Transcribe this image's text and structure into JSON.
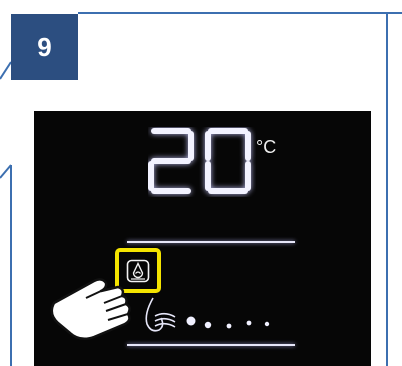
{
  "step": {
    "number": "9"
  },
  "display": {
    "temperature": "20",
    "unit": "°C"
  },
  "icons": {
    "button": "ventilation-icon",
    "fan_level": "fan-speed-icon",
    "pointer": "hand-pointer-icon"
  },
  "colors": {
    "badge": "#2c4e80",
    "frame_line": "#3c6fb0",
    "panel": "#060606",
    "highlight": "#f4e400",
    "glow": "#e6e6f8"
  }
}
